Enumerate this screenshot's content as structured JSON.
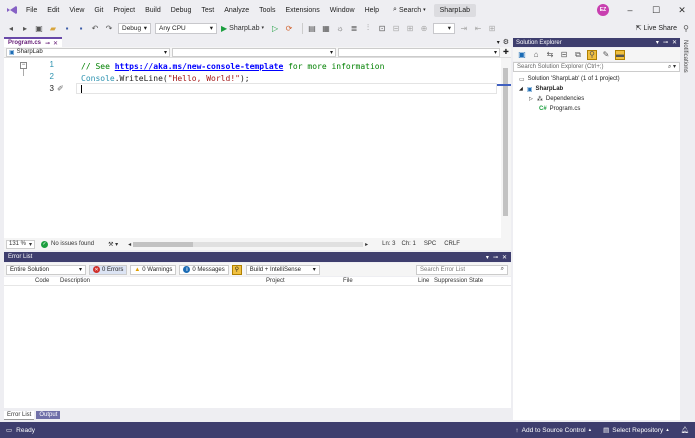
{
  "menubar": {
    "items": [
      "File",
      "Edit",
      "View",
      "Git",
      "Project",
      "Build",
      "Debug",
      "Test",
      "Analyze",
      "Tools",
      "Extensions",
      "Window",
      "Help"
    ],
    "search_label": "Search",
    "solution_name": "SharpLab",
    "avatar_initials": "EZ"
  },
  "toolbar": {
    "config": "Debug",
    "platform": "Any CPU",
    "run_label": "SharpLab",
    "live_share": "Live Share"
  },
  "editor": {
    "tab_label": "Program.cs",
    "nav_project": "SharpLab",
    "lines": [
      {
        "num": "1",
        "comment_prefix": "// See ",
        "link": "https://aka.ms/new-console-template",
        "comment_suffix": " for more information"
      },
      {
        "num": "2",
        "cls": "Console",
        "method": ".WriteLine(",
        "str": "\"Hello, World!\"",
        "end": ");"
      },
      {
        "num": "3"
      }
    ],
    "status": {
      "zoom": "131 %",
      "issues": "No issues found",
      "ln": "Ln: 3",
      "ch": "Ch: 1",
      "spc": "SPC",
      "crlf": "CRLF"
    }
  },
  "errorlist": {
    "title": "Error List",
    "scope": "Entire Solution",
    "errors": "0 Errors",
    "warnings": "0 Warnings",
    "messages": "0 Messages",
    "source": "Build + IntelliSense",
    "search_placeholder": "Search Error List",
    "columns": {
      "code": "Code",
      "description": "Description",
      "project": "Project",
      "file": "File",
      "line": "Line",
      "suppression": "Suppression State"
    }
  },
  "bottom_tabs": {
    "error_list": "Error List",
    "output": "Output"
  },
  "solution_explorer": {
    "title": "Solution Explorer",
    "search_placeholder": "Search Solution Explorer (Ctrl+;)",
    "solution": "Solution 'SharpLab' (1 of 1 project)",
    "project": "SharpLab",
    "dependencies": "Dependencies",
    "file": "Program.cs"
  },
  "notifications_label": "Notifications",
  "statusbar": {
    "ready": "Ready",
    "source_control": "Add to Source Control",
    "repository": "Select Repository"
  },
  "colors": {
    "accent": "#68217a",
    "statusbar": "#3e3e6e"
  }
}
